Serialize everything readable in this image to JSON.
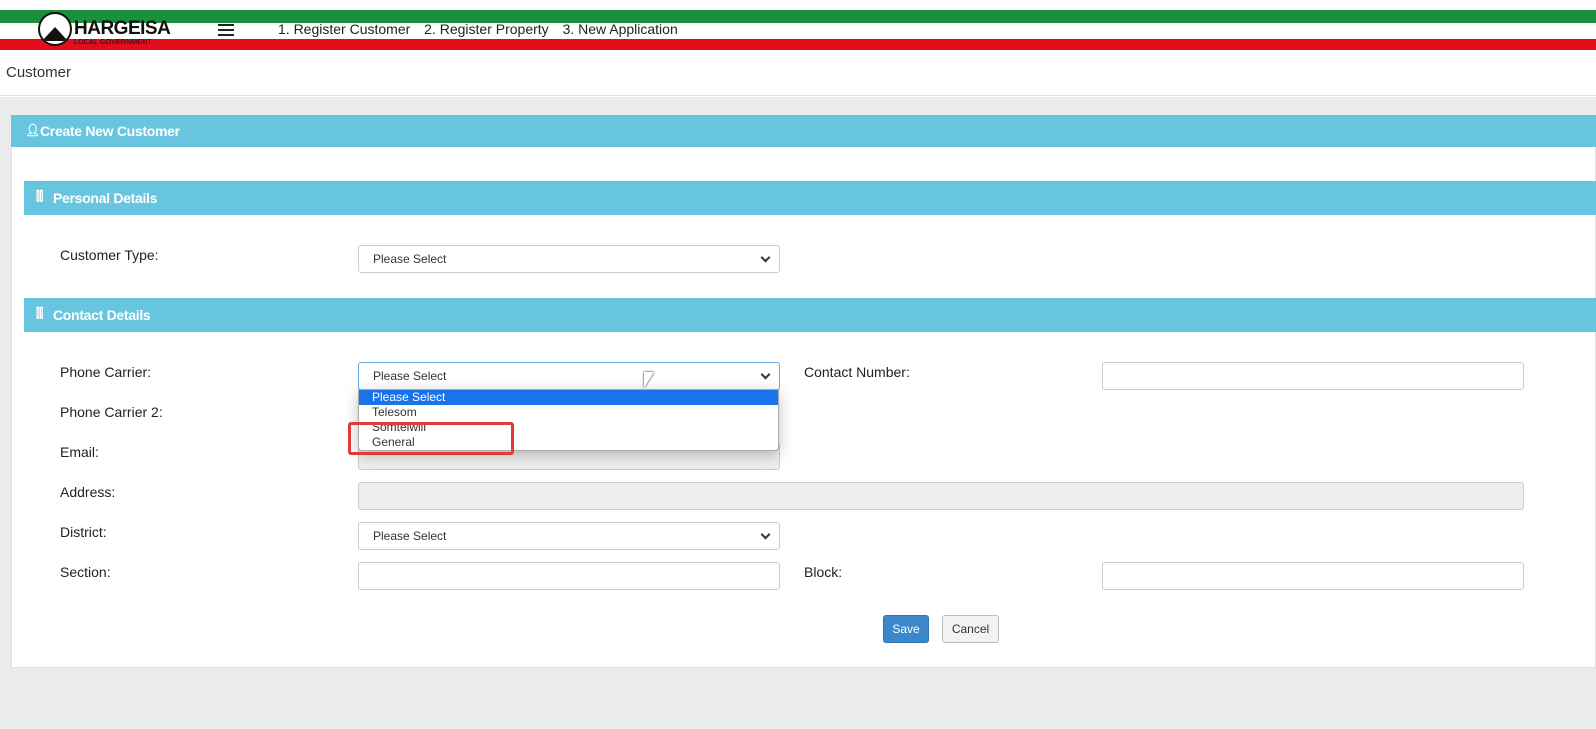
{
  "header": {
    "logo_title": "HARGEISA",
    "logo_subtitle": "LOCAL GOVERNMENT",
    "nav": [
      "1. Register Customer",
      "2. Register Property",
      "3. New Application"
    ]
  },
  "breadcrumb": "Customer",
  "card_title": "Create New Customer",
  "sections": {
    "personal": "Personal Details",
    "contact": "Contact Details"
  },
  "form": {
    "customer_type": {
      "label": "Customer Type",
      "value": "Please Select"
    },
    "phone_carrier": {
      "label": "Phone Carrier",
      "value": "Please Select",
      "options": [
        "Please Select",
        "Telesom",
        "Somtelwill",
        "General"
      ]
    },
    "contact_number": {
      "label": "Contact Number",
      "value": ""
    },
    "phone_carrier_2": {
      "label": "Phone Carrier 2"
    },
    "email": {
      "label": "Email",
      "value": ""
    },
    "address": {
      "label": "Address",
      "value": ""
    },
    "district": {
      "label": "District",
      "value": "Please Select"
    },
    "section": {
      "label": "Section",
      "value": ""
    },
    "block": {
      "label": "Block",
      "value": ""
    },
    "colon": ":"
  },
  "buttons": {
    "save": "Save",
    "cancel": "Cancel"
  },
  "colors": {
    "header_accent": "#68c5e0",
    "save_button": "#3c87c9",
    "selected_option": "#1a73e8",
    "highlight": "#e03b3b"
  }
}
